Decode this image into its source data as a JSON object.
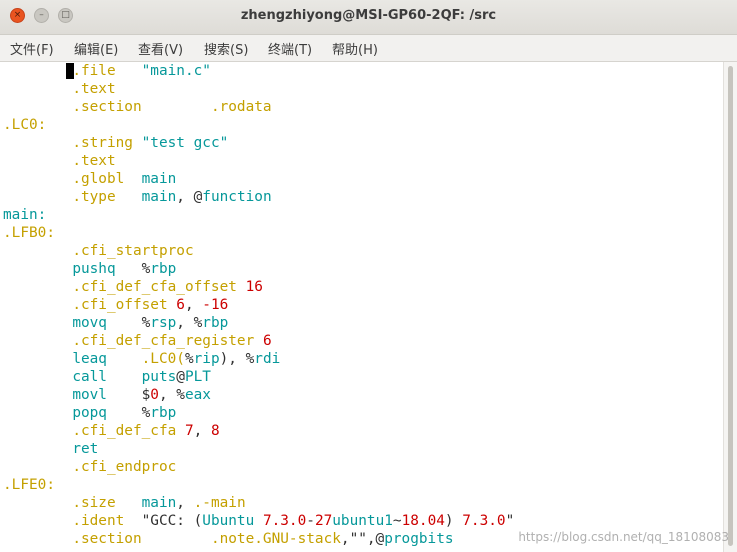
{
  "window": {
    "title": "zhengzhiyong@MSI-GP60-2QF: /src",
    "buttons": {
      "close_glyph": "×",
      "minimize_glyph": "–",
      "maximize_glyph": "□"
    }
  },
  "menubar": {
    "items": [
      {
        "label": "文件(F)"
      },
      {
        "label": "编辑(E)"
      },
      {
        "label": "查看(V)"
      },
      {
        "label": "搜索(S)"
      },
      {
        "label": "终端(T)"
      },
      {
        "label": "帮助(H)"
      }
    ]
  },
  "colors": {
    "directive": "#c4a000",
    "label": "#c4a000",
    "identifier": "#06989a",
    "number": "#cc0000",
    "plain": "#303030",
    "titlebar": "#dedcd7",
    "close_button": "#e95420"
  },
  "terminal": {
    "lines": [
      [
        {
          "t": "        ",
          "c": "plain"
        },
        {
          "t": ".file",
          "c": "dir"
        },
        {
          "t": "   ",
          "c": "plain"
        },
        {
          "t": "\"main.c\"",
          "c": "string"
        }
      ],
      [
        {
          "t": "        ",
          "c": "plain"
        },
        {
          "t": ".text",
          "c": "dir"
        }
      ],
      [
        {
          "t": "        ",
          "c": "plain"
        },
        {
          "t": ".section",
          "c": "dir"
        },
        {
          "t": "        ",
          "c": "plain"
        },
        {
          "t": ".rodata",
          "c": "dir"
        }
      ],
      [
        {
          "t": ".LC0:",
          "c": "label"
        }
      ],
      [
        {
          "t": "        ",
          "c": "plain"
        },
        {
          "t": ".string",
          "c": "dir"
        },
        {
          "t": " ",
          "c": "plain"
        },
        {
          "t": "\"test gcc\"",
          "c": "string"
        }
      ],
      [
        {
          "t": "        ",
          "c": "plain"
        },
        {
          "t": ".text",
          "c": "dir"
        }
      ],
      [
        {
          "t": "        ",
          "c": "plain"
        },
        {
          "t": ".globl",
          "c": "dir"
        },
        {
          "t": "  ",
          "c": "plain"
        },
        {
          "t": "main",
          "c": "ident"
        }
      ],
      [
        {
          "t": "        ",
          "c": "plain"
        },
        {
          "t": ".type",
          "c": "dir"
        },
        {
          "t": "   ",
          "c": "plain"
        },
        {
          "t": "main",
          "c": "ident"
        },
        {
          "t": ", @",
          "c": "plain"
        },
        {
          "t": "function",
          "c": "ident"
        }
      ],
      [
        {
          "t": "main:",
          "c": "ident"
        }
      ],
      [
        {
          "t": ".LFB0:",
          "c": "label"
        }
      ],
      [
        {
          "t": "        ",
          "c": "plain"
        },
        {
          "t": ".cfi_startproc",
          "c": "dir"
        }
      ],
      [
        {
          "t": "        ",
          "c": "plain"
        },
        {
          "t": "pushq",
          "c": "ident"
        },
        {
          "t": "   %",
          "c": "plain"
        },
        {
          "t": "rbp",
          "c": "register"
        }
      ],
      [
        {
          "t": "        ",
          "c": "plain"
        },
        {
          "t": ".cfi_def_cfa_offset",
          "c": "dir"
        },
        {
          "t": " ",
          "c": "plain"
        },
        {
          "t": "16",
          "c": "number"
        }
      ],
      [
        {
          "t": "        ",
          "c": "plain"
        },
        {
          "t": ".cfi_offset",
          "c": "dir"
        },
        {
          "t": " ",
          "c": "plain"
        },
        {
          "t": "6",
          "c": "number"
        },
        {
          "t": ", ",
          "c": "plain"
        },
        {
          "t": "-16",
          "c": "number"
        }
      ],
      [
        {
          "t": "        ",
          "c": "plain"
        },
        {
          "t": "movq",
          "c": "ident"
        },
        {
          "t": "    %",
          "c": "plain"
        },
        {
          "t": "rsp",
          "c": "register"
        },
        {
          "t": ", %",
          "c": "plain"
        },
        {
          "t": "rbp",
          "c": "register"
        }
      ],
      [
        {
          "t": "        ",
          "c": "plain"
        },
        {
          "t": ".cfi_def_cfa_register",
          "c": "dir"
        },
        {
          "t": " ",
          "c": "plain"
        },
        {
          "t": "6",
          "c": "number"
        }
      ],
      [
        {
          "t": "        ",
          "c": "plain"
        },
        {
          "t": "leaq",
          "c": "ident"
        },
        {
          "t": "    ",
          "c": "plain"
        },
        {
          "t": ".LC0(",
          "c": "dir"
        },
        {
          "t": "%",
          "c": "plain"
        },
        {
          "t": "rip",
          "c": "register"
        },
        {
          "t": "), %",
          "c": "plain"
        },
        {
          "t": "rdi",
          "c": "register"
        }
      ],
      [
        {
          "t": "        ",
          "c": "plain"
        },
        {
          "t": "call",
          "c": "ident"
        },
        {
          "t": "    ",
          "c": "plain"
        },
        {
          "t": "puts",
          "c": "ident"
        },
        {
          "t": "@",
          "c": "plain"
        },
        {
          "t": "PLT",
          "c": "ident"
        }
      ],
      [
        {
          "t": "        ",
          "c": "plain"
        },
        {
          "t": "movl",
          "c": "ident"
        },
        {
          "t": "    $",
          "c": "plain"
        },
        {
          "t": "0",
          "c": "number"
        },
        {
          "t": ", %",
          "c": "plain"
        },
        {
          "t": "eax",
          "c": "register"
        }
      ],
      [
        {
          "t": "        ",
          "c": "plain"
        },
        {
          "t": "popq",
          "c": "ident"
        },
        {
          "t": "    %",
          "c": "plain"
        },
        {
          "t": "rbp",
          "c": "register"
        }
      ],
      [
        {
          "t": "        ",
          "c": "plain"
        },
        {
          "t": ".cfi_def_cfa",
          "c": "dir"
        },
        {
          "t": " ",
          "c": "plain"
        },
        {
          "t": "7",
          "c": "number"
        },
        {
          "t": ", ",
          "c": "plain"
        },
        {
          "t": "8",
          "c": "number"
        }
      ],
      [
        {
          "t": "        ",
          "c": "plain"
        },
        {
          "t": "ret",
          "c": "ident"
        }
      ],
      [
        {
          "t": "        ",
          "c": "plain"
        },
        {
          "t": ".cfi_endproc",
          "c": "dir"
        }
      ],
      [
        {
          "t": ".LFE0:",
          "c": "label"
        }
      ],
      [
        {
          "t": "        ",
          "c": "plain"
        },
        {
          "t": ".size",
          "c": "dir"
        },
        {
          "t": "   ",
          "c": "plain"
        },
        {
          "t": "main",
          "c": "ident"
        },
        {
          "t": ", ",
          "c": "plain"
        },
        {
          "t": ".-main",
          "c": "dir"
        }
      ],
      [
        {
          "t": "        ",
          "c": "plain"
        },
        {
          "t": ".ident",
          "c": "dir"
        },
        {
          "t": "  ",
          "c": "plain"
        },
        {
          "t": "\"GCC: (",
          "c": "plain"
        },
        {
          "t": "Ubuntu",
          "c": "ident"
        },
        {
          "t": " ",
          "c": "plain"
        },
        {
          "t": "7.3.0",
          "c": "number"
        },
        {
          "t": "-",
          "c": "plain"
        },
        {
          "t": "27",
          "c": "number"
        },
        {
          "t": "ubuntu1",
          "c": "ident"
        },
        {
          "t": "~",
          "c": "plain"
        },
        {
          "t": "18.04",
          "c": "number"
        },
        {
          "t": ") ",
          "c": "plain"
        },
        {
          "t": "7.3.0",
          "c": "number"
        },
        {
          "t": "\"",
          "c": "plain"
        }
      ],
      [
        {
          "t": "        ",
          "c": "plain"
        },
        {
          "t": ".section",
          "c": "dir"
        },
        {
          "t": "        ",
          "c": "plain"
        },
        {
          "t": ".note.GNU-stack",
          "c": "dir"
        },
        {
          "t": ",\"\",@",
          "c": "plain"
        },
        {
          "t": "progbits",
          "c": "ident"
        }
      ]
    ]
  },
  "watermark": "https://blog.csdn.net/qq_18108083"
}
